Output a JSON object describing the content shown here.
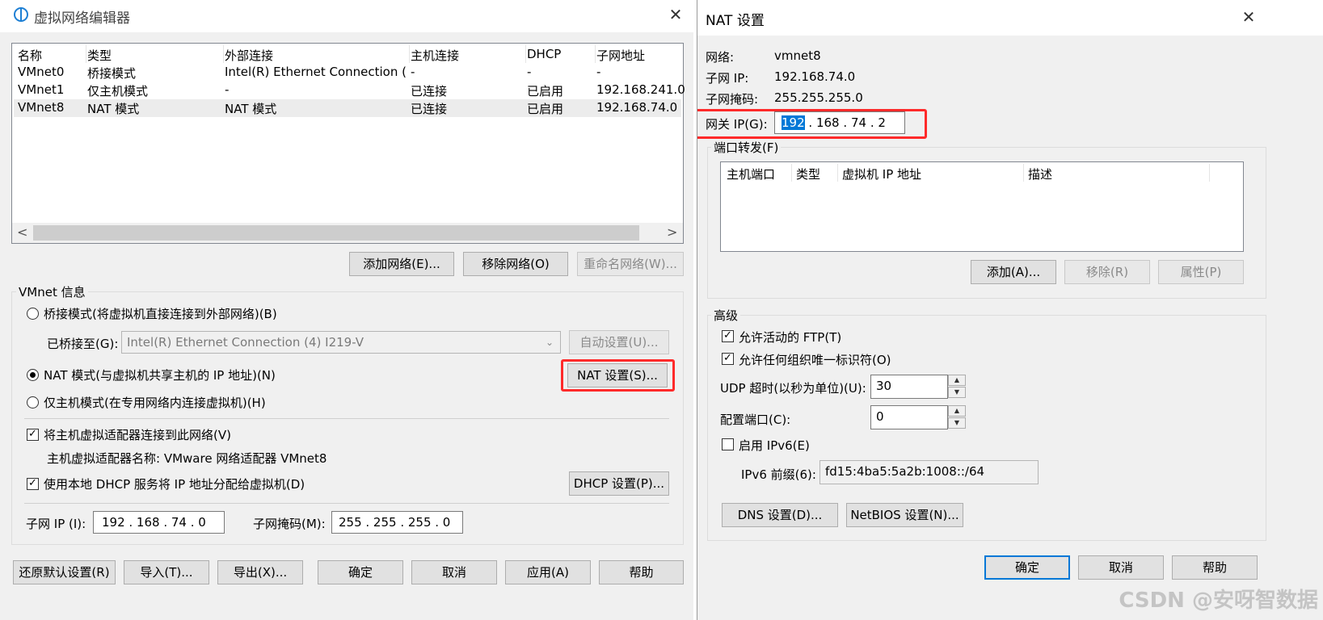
{
  "left_window": {
    "title": "虚拟网络编辑器",
    "close_glyph": "✕",
    "table": {
      "headers": [
        "名称",
        "类型",
        "外部连接",
        "主机连接",
        "DHCP",
        "子网地址"
      ],
      "rows": [
        [
          "VMnet0",
          "桥接模式",
          "Intel(R) Ethernet Connection (...",
          "-",
          "-",
          "-"
        ],
        [
          "VMnet1",
          "仅主机模式",
          "-",
          "已连接",
          "已启用",
          "192.168.241.0"
        ],
        [
          "VMnet8",
          "NAT 模式",
          "NAT 模式",
          "已连接",
          "已启用",
          "192.168.74.0"
        ]
      ],
      "scroll_left": "<",
      "scroll_right": ">"
    },
    "buttons": {
      "add_network": "添加网络(E)...",
      "remove_network": "移除网络(O)",
      "rename_network": "重命名网络(W)..."
    },
    "vmnet_info": {
      "group_label": "VMnet 信息",
      "bridge_mode": "桥接模式(将虚拟机直接连接到外部网络)(B)",
      "bridged_to_label": "已桥接至(G):",
      "bridged_to_value": "Intel(R) Ethernet Connection (4) I219-V",
      "auto_settings": "自动设置(U)...",
      "nat_mode": "NAT 模式(与虚拟机共享主机的 IP 地址)(N)",
      "nat_settings": "NAT 设置(S)...",
      "host_only_mode": "仅主机模式(在专用网络内连接虚拟机)(H)",
      "connect_adapter": "将主机虚拟适配器连接到此网络(V)",
      "adapter_name": "主机虚拟适配器名称: VMware 网络适配器 VMnet8",
      "use_dhcp": "使用本地 DHCP 服务将 IP 地址分配给虚拟机(D)",
      "dhcp_settings": "DHCP 设置(P)...",
      "subnet_ip_label": "子网 IP (I):",
      "subnet_ip_value": "192 . 168 . 74 . 0",
      "subnet_mask_label": "子网掩码(M):",
      "subnet_mask_value": "255 . 255 . 255 . 0"
    },
    "footer": {
      "restore_defaults": "还原默认设置(R)",
      "import": "导入(T)...",
      "export": "导出(X)...",
      "ok": "确定",
      "cancel": "取消",
      "apply": "应用(A)",
      "help": "帮助"
    }
  },
  "right_window": {
    "title": "NAT 设置",
    "close_glyph": "✕",
    "network_label": "网络:",
    "network_value": "vmnet8",
    "subnet_ip_label": "子网 IP:",
    "subnet_ip_value": "192.168.74.0",
    "subnet_mask_label": "子网掩码:",
    "subnet_mask_value": "255.255.255.0",
    "gateway_label": "网关 IP(G):",
    "gateway_octets": [
      "192",
      "168",
      "74",
      "2"
    ],
    "port_forwarding": {
      "group_label": "端口转发(F)",
      "headers": [
        "主机端口",
        "类型",
        "虚拟机 IP 地址",
        "描述"
      ],
      "add": "添加(A)...",
      "remove": "移除(R)",
      "properties": "属性(P)"
    },
    "advanced": {
      "group_label": "高级",
      "allow_ftp": "允许活动的 FTP(T)",
      "allow_uid": "允许任何组织唯一标识符(O)",
      "udp_timeout_label": "UDP 超时(以秒为单位)(U):",
      "udp_timeout_value": "30",
      "config_port_label": "配置端口(C):",
      "config_port_value": "0",
      "enable_ipv6": "启用 IPv6(E)",
      "ipv6_prefix_label": "IPv6 前缀(6):",
      "ipv6_prefix_value": "fd15:4ba5:5a2b:1008::/64",
      "dns_settings": "DNS 设置(D)...",
      "netbios_settings": "NetBIOS 设置(N)..."
    },
    "footer": {
      "ok": "确定",
      "cancel": "取消",
      "help": "帮助"
    }
  },
  "watermark": "CSDN @安呀智数据",
  "highlight_color": "#ff2a2a",
  "selection_color": "#0078d7"
}
